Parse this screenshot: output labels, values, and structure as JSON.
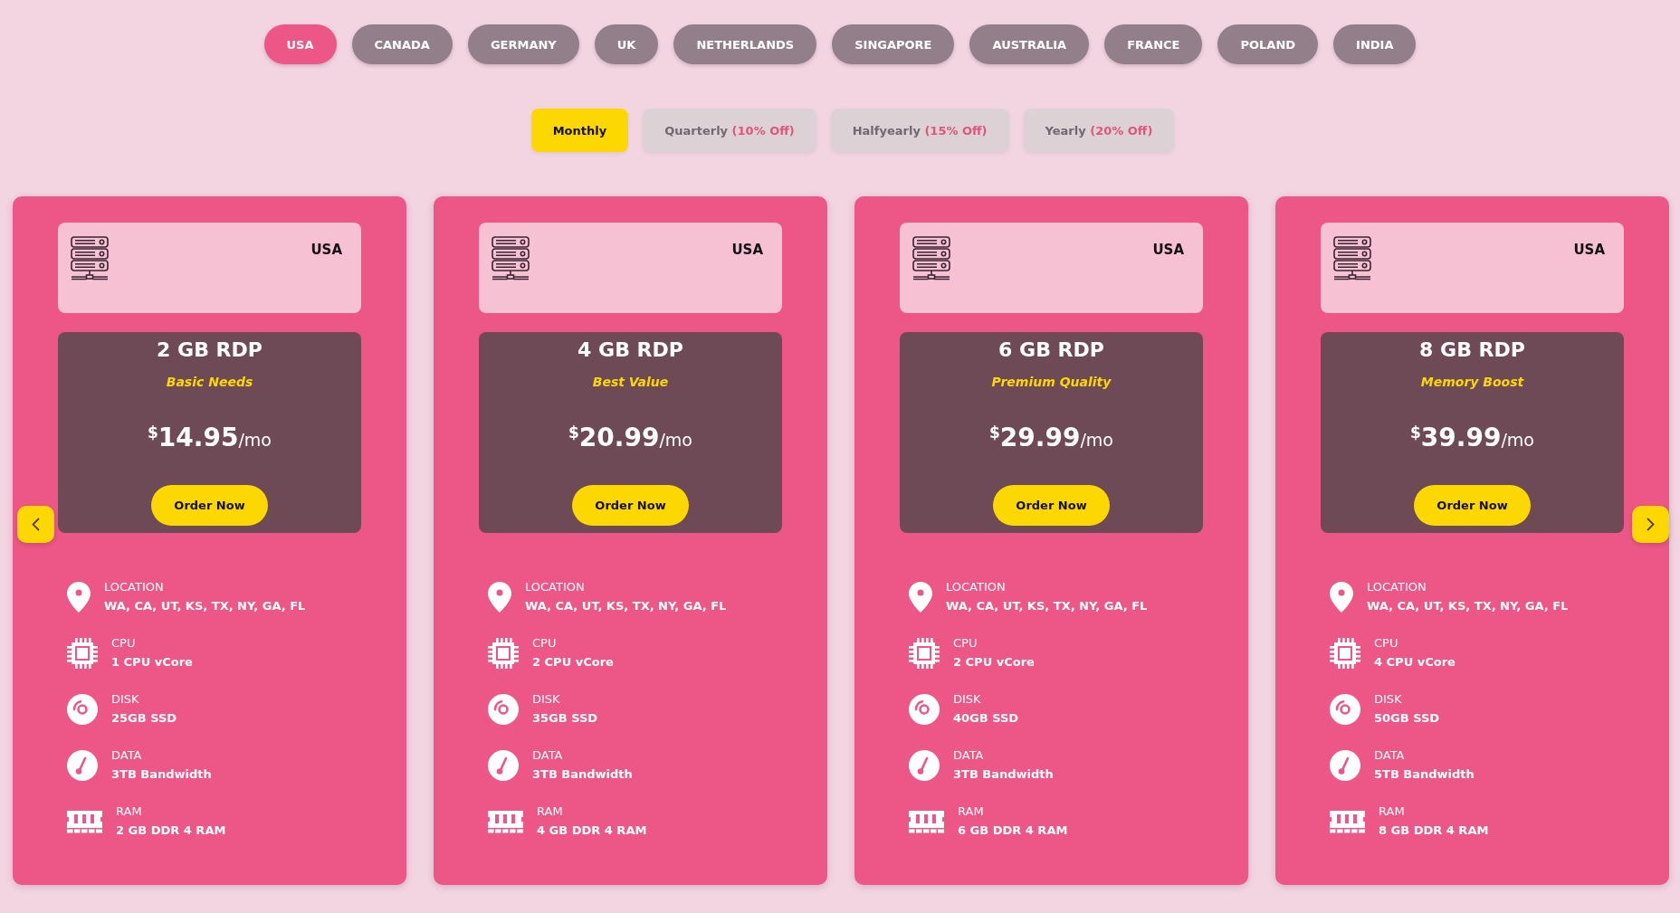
{
  "country_tabs": [
    {
      "label": "USA",
      "selected": true
    },
    {
      "label": "CANADA",
      "selected": false
    },
    {
      "label": "GERMANY",
      "selected": false
    },
    {
      "label": "UK",
      "selected": false
    },
    {
      "label": "NETHERLANDS",
      "selected": false
    },
    {
      "label": "SINGAPORE",
      "selected": false
    },
    {
      "label": "AUSTRALIA",
      "selected": false
    },
    {
      "label": "FRANCE",
      "selected": false
    },
    {
      "label": "POLAND",
      "selected": false
    },
    {
      "label": "INDIA",
      "selected": false
    }
  ],
  "billing_tabs": [
    {
      "label": "Monthly",
      "selected": true
    },
    {
      "label": "Quarterly",
      "discount": "(10% Off)",
      "selected": false
    },
    {
      "label": "Halfyearly",
      "discount": "(15% Off)",
      "selected": false
    },
    {
      "label": "Yearly",
      "discount": "(20% Off)",
      "selected": false
    }
  ],
  "plans": [
    {
      "country": "USA",
      "name": "2 GB RDP",
      "tagline": "Basic Needs",
      "currency": "$",
      "price": "14.95",
      "period": "/mo",
      "button": "Order Now",
      "specs": [
        {
          "kind": "location",
          "label": "LOCATION",
          "value": "WA, CA, UT, KS, TX, NY, GA, FL"
        },
        {
          "kind": "cpu",
          "label": "CPU",
          "value": "1 CPU vCore"
        },
        {
          "kind": "disk",
          "label": "DISK",
          "value": "25GB SSD"
        },
        {
          "kind": "data",
          "label": "DATA",
          "value": "3TB Bandwidth"
        },
        {
          "kind": "ram",
          "label": "RAM",
          "value": "2 GB DDR 4 RAM"
        }
      ]
    },
    {
      "country": "USA",
      "name": "4 GB RDP",
      "tagline": "Best Value",
      "currency": "$",
      "price": "20.99",
      "period": "/mo",
      "button": "Order Now",
      "specs": [
        {
          "kind": "location",
          "label": "LOCATION",
          "value": "WA, CA, UT, KS, TX, NY, GA, FL"
        },
        {
          "kind": "cpu",
          "label": "CPU",
          "value": "2 CPU vCore"
        },
        {
          "kind": "disk",
          "label": "DISK",
          "value": "35GB SSD"
        },
        {
          "kind": "data",
          "label": "DATA",
          "value": "3TB Bandwidth"
        },
        {
          "kind": "ram",
          "label": "RAM",
          "value": "4 GB DDR 4 RAM"
        }
      ]
    },
    {
      "country": "USA",
      "name": "6 GB RDP",
      "tagline": "Premium Quality",
      "currency": "$",
      "price": "29.99",
      "period": "/mo",
      "button": "Order Now",
      "specs": [
        {
          "kind": "location",
          "label": "LOCATION",
          "value": "WA, CA, UT, KS, TX, NY, GA, FL"
        },
        {
          "kind": "cpu",
          "label": "CPU",
          "value": "2 CPU vCore"
        },
        {
          "kind": "disk",
          "label": "DISK",
          "value": "40GB SSD"
        },
        {
          "kind": "data",
          "label": "DATA",
          "value": "3TB Bandwidth"
        },
        {
          "kind": "ram",
          "label": "RAM",
          "value": "6 GB DDR 4 RAM"
        }
      ]
    },
    {
      "country": "USA",
      "name": "8 GB RDP",
      "tagline": "Memory Boost",
      "currency": "$",
      "price": "39.99",
      "period": "/mo",
      "button": "Order Now",
      "specs": [
        {
          "kind": "location",
          "label": "LOCATION",
          "value": "WA, CA, UT, KS, TX, NY, GA, FL"
        },
        {
          "kind": "cpu",
          "label": "CPU",
          "value": "4 CPU vCore"
        },
        {
          "kind": "disk",
          "label": "DISK",
          "value": "50GB SSD"
        },
        {
          "kind": "data",
          "label": "DATA",
          "value": "5TB Bandwidth"
        },
        {
          "kind": "ram",
          "label": "RAM",
          "value": "8 GB DDR 4 RAM"
        }
      ]
    }
  ]
}
